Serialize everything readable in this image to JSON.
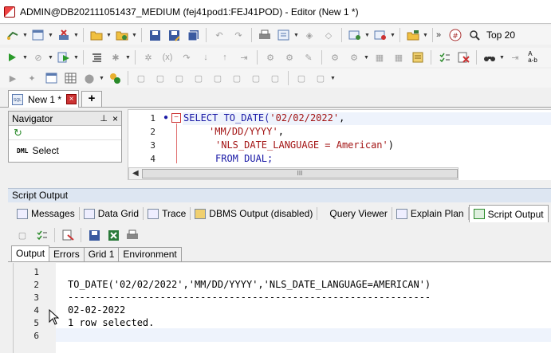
{
  "window": {
    "title": "ADMIN@DB202111051437_MEDIUM (fej41pod1:FEJ41POD) - Editor (New 1 *)"
  },
  "toolbar": {
    "top_label": "Top 20"
  },
  "document_tabs": [
    {
      "label": "New 1 *"
    }
  ],
  "navigator": {
    "title": "Navigator",
    "items": [
      {
        "tag": "DML",
        "label": "Select"
      }
    ]
  },
  "editor": {
    "line_numbers": [
      "1",
      "2",
      "3",
      "4"
    ],
    "lines": [
      {
        "kw": "SELECT TO_DATE(",
        "str": "'02/02/2022'",
        "rest": ","
      },
      {
        "kw": "",
        "str": "'MM/DD/YYYY'",
        "rest": ","
      },
      {
        "kw": "",
        "str": "'NLS_DATE_LANGUAGE = American'",
        "rest": ")"
      },
      {
        "kw": "FROM DUAL;",
        "str": "",
        "rest": ""
      }
    ],
    "scroll_thumb": "III"
  },
  "script_output": {
    "title": "Script Output",
    "tabs": [
      {
        "label": "Messages",
        "icon": "messages-icon"
      },
      {
        "label": "Data Grid",
        "icon": "data-grid-icon"
      },
      {
        "label": "Trace",
        "icon": "trace-icon"
      },
      {
        "label": "DBMS Output (disabled)",
        "icon": "dbms-output-icon"
      },
      {
        "label": "Query Viewer",
        "icon": "query-viewer-icon"
      },
      {
        "label": "Explain Plan",
        "icon": "explain-plan-icon"
      },
      {
        "label": "Script Output",
        "icon": "script-output-icon"
      }
    ],
    "output_tabs": [
      "Output",
      "Errors",
      "Grid 1",
      "Environment"
    ],
    "line_numbers": [
      "1",
      "2",
      "3",
      "4",
      "5",
      "6"
    ],
    "lines": [
      "",
      "TO_DATE('02/02/2022','MM/DD/YYYY','NLS_DATE_LANGUAGE=AMERICAN')",
      "---------------------------------------------------------------",
      "02-02-2022",
      "1 row selected.",
      ""
    ]
  },
  "colors": {
    "keyword": "#1a1aa6",
    "string": "#a31515",
    "current_line": "#eef3fc"
  }
}
